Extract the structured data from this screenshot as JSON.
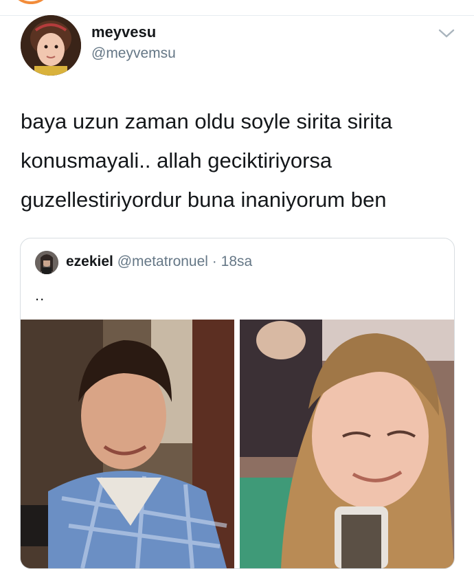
{
  "author": {
    "display_name": "meyvesu",
    "handle": "@meyvemsu"
  },
  "tweet": {
    "text": "baya uzun zaman oldu soyle sirita sirita\nkonusmayali.. allah geciktiriyorsa\nguzellestiriyordur buna inaniyorum ben"
  },
  "quoted_tweet": {
    "display_name": "ezekiel",
    "handle": "@metatronuel",
    "separator": "·",
    "time": "18sa",
    "text": ".."
  },
  "icons": {
    "menu": "chevron-down-icon"
  },
  "colors": {
    "text": "#14171a",
    "secondary_text": "#657786",
    "border": "#d8dde1",
    "chevron": "#a9b4bd"
  }
}
